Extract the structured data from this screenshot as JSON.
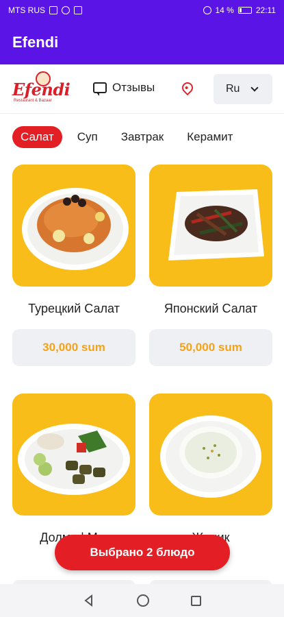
{
  "status_bar": {
    "carrier": "MTS RUS",
    "battery": "14 %",
    "time": "22:11"
  },
  "app_bar": {
    "title": "Efendi"
  },
  "header": {
    "logo_word": "Efendi",
    "logo_sub": "Restaurant & Bazaar",
    "reviews_label": "Отзывы",
    "language": "Ru"
  },
  "tabs": [
    {
      "label": "Салат",
      "active": true
    },
    {
      "label": "Суп",
      "active": false
    },
    {
      "label": "Завтрак",
      "active": false
    },
    {
      "label": "Керамит",
      "active": false
    }
  ],
  "products": [
    {
      "name": "Турецкий Салат",
      "price": "30,000 sum"
    },
    {
      "name": "Японский Салат",
      "price": "50,000 sum"
    },
    {
      "name": "Долма | М...",
      "price": ""
    },
    {
      "name": "Жацик",
      "price": ""
    }
  ],
  "cart_button": {
    "label": "Выбрано 2 блюдо"
  },
  "colors": {
    "primary": "#5b14e6",
    "accent": "#e31e24",
    "card_bg": "#f9bd1a",
    "price": "#f2a31a"
  }
}
